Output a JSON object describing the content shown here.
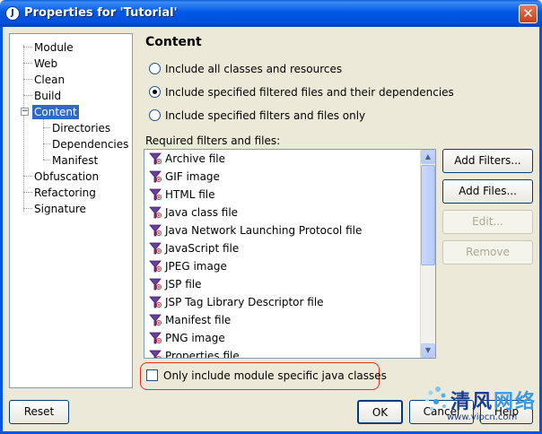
{
  "window": {
    "title": "Properties for 'Tutorial'",
    "close_label": "✕"
  },
  "tree": {
    "items": [
      {
        "label": "Module"
      },
      {
        "label": "Web"
      },
      {
        "label": "Clean"
      },
      {
        "label": "Build"
      },
      {
        "label": "Content",
        "selected": true
      },
      {
        "label": "Directories"
      },
      {
        "label": "Dependencies"
      },
      {
        "label": "Manifest"
      },
      {
        "label": "Obfuscation"
      },
      {
        "label": "Refactoring"
      },
      {
        "label": "Signature"
      }
    ],
    "expander": "−"
  },
  "content": {
    "heading": "Content",
    "radios": [
      {
        "label": "Include all classes and resources",
        "checked": false
      },
      {
        "label": "Include specified filtered files and their dependencies",
        "checked": true
      },
      {
        "label": "Include specified filters and files only",
        "checked": false
      }
    ],
    "list_label": "Required filters and files:",
    "list_items": [
      "Archive file",
      "GIF image",
      "HTML file",
      "Java class file",
      "Java Network Launching Protocol file",
      "JavaScript file",
      "JPEG image",
      "JSP file",
      "JSP Tag Library Descriptor file",
      "Manifest file",
      "PNG image",
      "Properties file"
    ],
    "buttons": {
      "add_filters": "Add Filters...",
      "add_files": "Add Files...",
      "edit": "Edit...",
      "remove": "Remove"
    },
    "checkbox_label": "Only include module specific java classes",
    "checkbox_checked": false
  },
  "footer": {
    "reset": "Reset",
    "ok": "OK",
    "cancel": "Cancel",
    "help": "Help"
  },
  "watermark": {
    "brand_a": "清风",
    "brand_b": "网络",
    "url": "www.vipcn.com"
  },
  "colors": {
    "titlebar": "#0058e6",
    "selection": "#316ac5",
    "highlight": "#e0301e"
  }
}
